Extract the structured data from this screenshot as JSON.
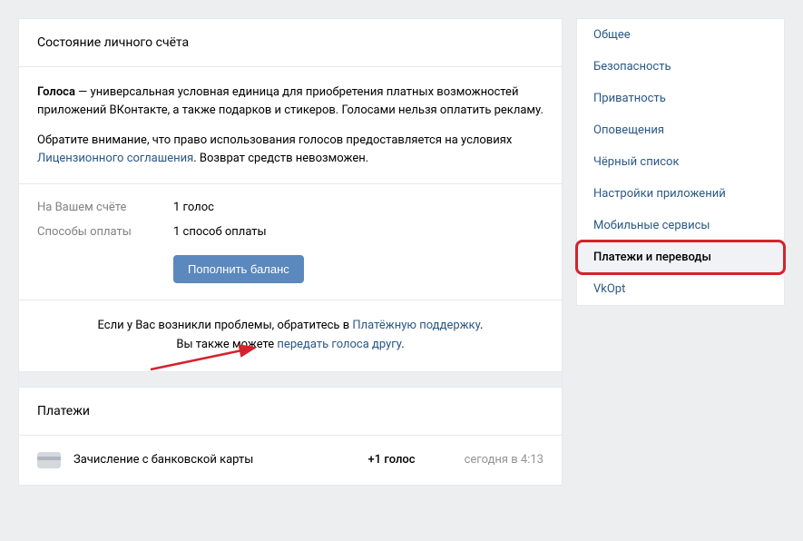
{
  "main": {
    "header": "Состояние личного счёта",
    "desc": {
      "bold": "Голоса",
      "p1": " — универсальная условная единица для приобретения платных возможностей приложений ВКонтакте, а также подарков и стикеров. Голосами нельзя оплатить рекламу.",
      "p2a": "Обратите внимание, что право использования голосов предоставляется на условиях ",
      "p2link": "Лицензионного соглашения",
      "p2b": ". Возврат средств невозможен."
    },
    "balance": {
      "account_label": "На Вашем счёте",
      "account_value": "1 голос",
      "methods_label": "Способы оплаты",
      "methods_value": "1 способ оплаты",
      "topup_button": "Пополнить баланс"
    },
    "info": {
      "line1a": "Если у Вас возникли проблемы, обратитесь в ",
      "line1link": "Платёжную поддержку",
      "line1b": ".",
      "line2a": "Вы также можете ",
      "line2link": "передать голоса другу",
      "line2b": "."
    },
    "payments": {
      "header": "Платежи",
      "row": {
        "description": "Зачисление с банковской карты",
        "amount": "+1 голос",
        "date": "сегодня в 4:13"
      }
    }
  },
  "sidebar": {
    "items": [
      {
        "label": "Общее"
      },
      {
        "label": "Безопасность"
      },
      {
        "label": "Приватность"
      },
      {
        "label": "Оповещения"
      },
      {
        "label": "Чёрный список"
      },
      {
        "label": "Настройки приложений"
      },
      {
        "label": "Мобильные сервисы"
      },
      {
        "label": "Платежи и переводы"
      },
      {
        "label": "VkOpt"
      }
    ]
  }
}
